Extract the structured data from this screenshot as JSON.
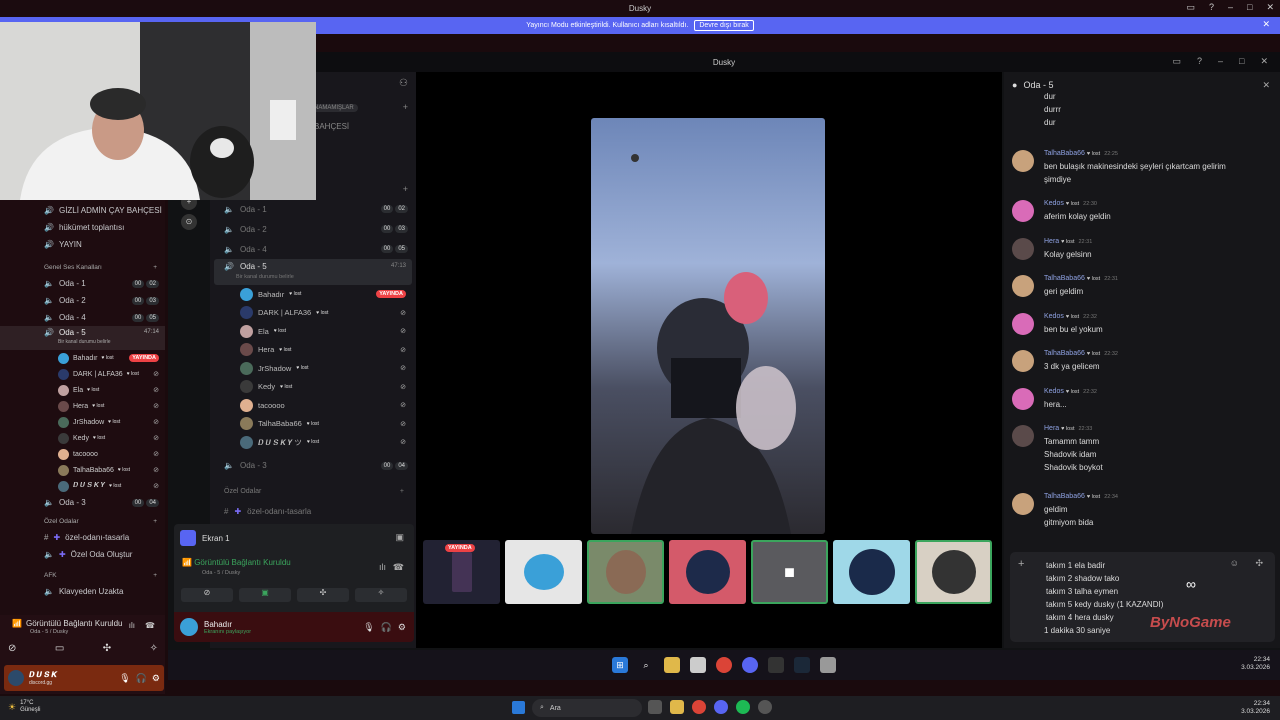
{
  "window": {
    "title": "Dusky"
  },
  "banner": {
    "text": "Yayıncı Modu etkinleştirildi. Kullanıcı adları kısaltıldı.",
    "button": "Devre dışı bırak"
  },
  "sidebar": {
    "channels_top": [
      "GİZLİ ADMİN ÇAY BAHÇESİ",
      "hükümet toplantısı",
      "YAYIN"
    ],
    "category": "Genel Ses Kanalları",
    "voice_channels": [
      {
        "name": "Oda - 1",
        "pills": [
          "00",
          "02"
        ]
      },
      {
        "name": "Oda - 2",
        "pills": [
          "00",
          "03"
        ]
      },
      {
        "name": "Oda - 4",
        "pills": [
          "00",
          "05"
        ]
      }
    ],
    "active_channel": {
      "name": "Oda - 5",
      "time": "47:14",
      "status": "Bir kanal durumu belirle"
    },
    "members": [
      {
        "name": "Bahadır",
        "tag": "lost",
        "live": "YAYINDA"
      },
      {
        "name": "DARK | ALFA36",
        "tag": "lost"
      },
      {
        "name": "Ela",
        "tag": "lost"
      },
      {
        "name": "Hera",
        "tag": "lost"
      },
      {
        "name": "JrShadow",
        "tag": "lost"
      },
      {
        "name": "Kedy",
        "tag": "lost"
      },
      {
        "name": "tacoooo",
        "tag": ""
      },
      {
        "name": "TalhaBaba66",
        "tag": "lost"
      },
      {
        "name": "𝑫 𝑼 𝑺 𝑲 𝒀",
        "tag": "lost"
      }
    ],
    "after_channel": "Oda - 3",
    "after_pills": [
      "00",
      "04"
    ],
    "private_category": "Özel Odalar",
    "private_channels": [
      "özel-odanı-tasarla",
      "Özel Oda Oluştur"
    ],
    "afk_category": "AFK",
    "afk_channel": "Klavyeden Uzakta",
    "voice_status": "Görüntülü Bağlantı Kuruldu",
    "voice_sub": "Oda - 5 / Dusky",
    "user_name": "𝑫 𝑼 𝑺 𝑲",
    "user_sub": "discord.gg"
  },
  "channels_panel": {
    "partial_top": [
      "NAMAMIŞLAR",
      "BAHÇESİ"
    ],
    "rooms": [
      {
        "name": "Oda - 1",
        "pills": [
          "00",
          "02"
        ]
      },
      {
        "name": "Oda - 2",
        "pills": [
          "00",
          "03"
        ]
      },
      {
        "name": "Oda - 4",
        "pills": [
          "00",
          "05"
        ]
      }
    ],
    "active": {
      "name": "Oda - 5",
      "time": "47:13",
      "status": "Bir kanal durumu belirle"
    },
    "members": [
      {
        "name": "Bahadır",
        "tag": "lost",
        "live": "YAYINDA"
      },
      {
        "name": "DARK | ALFA36",
        "tag": "lost"
      },
      {
        "name": "Ela",
        "tag": "lost"
      },
      {
        "name": "Hera",
        "tag": "lost"
      },
      {
        "name": "JrShadow",
        "tag": "lost"
      },
      {
        "name": "Kedy",
        "tag": "lost"
      },
      {
        "name": "tacoooo",
        "tag": ""
      },
      {
        "name": "TalhaBaba66",
        "tag": "lost"
      },
      {
        "name": "𝑫 𝑼 𝑺 𝑲 𝒀 ツ",
        "tag": "lost"
      }
    ],
    "after": {
      "name": "Oda - 3",
      "pills": [
        "00",
        "04"
      ]
    },
    "private_category": "Özel Odalar",
    "private_channel": "özel-odanı-tasarla",
    "screen_label": "Ekran 1",
    "voice_status": "Görüntülü Bağlantı Kuruldu",
    "voice_sub": "Oda - 5 / Dusky",
    "user_name": "Bahadır",
    "user_sub": "Ekranını paylaşıyor"
  },
  "stage": {
    "live_label": "YAYINDA"
  },
  "chat": {
    "channel": "Oda - 5",
    "messages": [
      {
        "lines": [
          "dur",
          "durrr",
          "dur"
        ]
      },
      {
        "author": "TalhaBaba66",
        "tag": "lost",
        "time": "22:25",
        "lines": [
          "ben bulaşık makinesindeki şeyleri çıkartcam gelirim",
          "şimdiye"
        ],
        "color": "#c8a27c"
      },
      {
        "author": "Kedos",
        "tag": "lost",
        "time": "22:30",
        "lines": [
          "aferim kolay geldin"
        ],
        "color": "#d96bb8"
      },
      {
        "author": "Hera",
        "tag": "lost",
        "time": "22:31",
        "lines": [
          "Kolay gelsinn"
        ],
        "color": "#5a4a4a"
      },
      {
        "author": "TalhaBaba66",
        "tag": "lost",
        "time": "22:31",
        "lines": [
          "geri geldim"
        ],
        "color": "#c8a27c"
      },
      {
        "author": "Kedos",
        "tag": "lost",
        "time": "22:32",
        "lines": [
          "ben bu el yokum"
        ],
        "color": "#d96bb8"
      },
      {
        "author": "TalhaBaba66",
        "tag": "lost",
        "time": "22:32",
        "lines": [
          "3 dk ya gelicem"
        ],
        "color": "#c8a27c"
      },
      {
        "author": "Kedos",
        "tag": "lost",
        "time": "22:32",
        "lines": [
          "hera..."
        ],
        "color": "#d96bb8"
      },
      {
        "author": "Hera",
        "tag": "lost",
        "time": "22:33",
        "lines": [
          "Tamamm tamm",
          "Shadovik idam",
          "Shadovik boykot"
        ],
        "color": "#5a4a4a"
      },
      {
        "author": "TalhaBaba66",
        "tag": "lost",
        "time": "22:34",
        "lines": [
          "geldim",
          "gitmiyom bida"
        ],
        "color": "#c8a27c"
      }
    ],
    "input_lines": [
      "takım 1 ela badir",
      "takım 2 shadow tako",
      "takım 3 talha eymen",
      "takım 5 kedy dusky (1 KAZANDI)",
      "takım 4 hera dusky",
      "1 dakika 30 saniye"
    ]
  },
  "watermark": "ByNoGame",
  "inner_taskbar": {
    "time": "22:34",
    "date": "3.03.2026"
  },
  "taskbar": {
    "weather_temp": "17°C",
    "weather_desc": "Güneşli",
    "search": "Ara",
    "time": "22:34",
    "date": "3.03.2026"
  }
}
